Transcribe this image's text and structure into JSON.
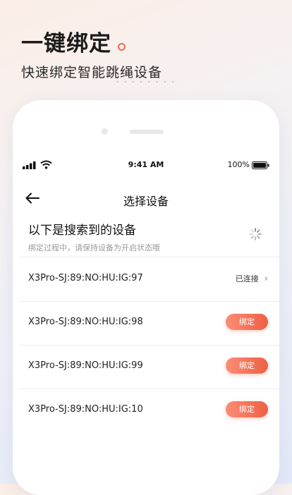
{
  "promo": {
    "title": "一键绑定",
    "subtitle": "快速绑定智能跳绳设备"
  },
  "status_bar": {
    "time": "9:41 AM",
    "battery": "100%"
  },
  "nav": {
    "title": "选择设备"
  },
  "list": {
    "heading": "以下是搜索到的设备",
    "hint": "绑定过程中，请保持设备为开启状态哦"
  },
  "devices": [
    {
      "name": "X3Pro-SJ:89:NO:HU:IG:97",
      "status": "已连接"
    },
    {
      "name": "X3Pro-SJ:89:NO:HU:IG:98",
      "action": "绑定"
    },
    {
      "name": "X3Pro-SJ:89:NO:HU:IG:99",
      "action": "绑定"
    },
    {
      "name": "X3Pro-SJ:89:NO:HU:IG:10",
      "action": "绑定"
    }
  ],
  "colors": {
    "accent": "#ef5f43",
    "accent_light": "#fa8e76"
  },
  "icons": [
    "signal-icon",
    "wifi-icon",
    "battery-icon",
    "back-arrow-icon",
    "loading-spinner-icon",
    "chevron-right-icon"
  ]
}
